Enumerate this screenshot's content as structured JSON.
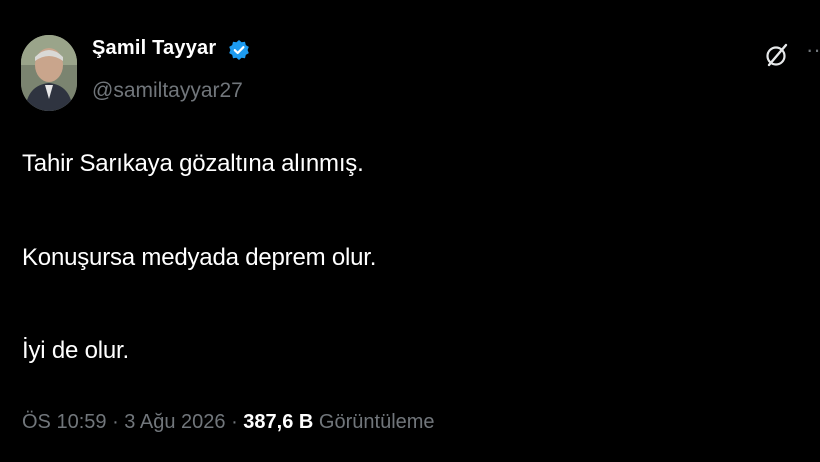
{
  "author": {
    "display_name": "Şamil Tayyar",
    "handle": "@samiltayyar27",
    "verified": true,
    "verified_color": "#1d9bf0"
  },
  "tweet": {
    "lines": [
      "Tahir Sarıkaya gözaltına alınmış.",
      "Konuşursa medyada deprem olur.",
      "İyi de olur."
    ]
  },
  "meta": {
    "time": "ÖS 10:59",
    "separator": " · ",
    "date": "3 Ağu 2026",
    "views_count": "387,6 B",
    "views_label": "Görüntüleme"
  },
  "icons": {
    "grok": "grok-icon",
    "more": "more-icon",
    "verified": "verified-badge-icon"
  },
  "colors": {
    "background": "#000000",
    "text": "#ffffff",
    "muted": "#71767b"
  }
}
